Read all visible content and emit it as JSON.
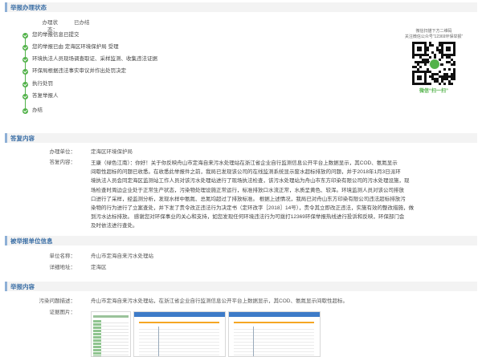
{
  "sections": {
    "status": "举报办理状态",
    "reply": "答复内容",
    "reported": "被举报单位信息",
    "report": "举报内容"
  },
  "status": {
    "label": "办理状态：",
    "value": "已办结",
    "steps": [
      "您的举报信息已提交",
      "您的举报已由 定海区环境保护局 受理",
      "环境执法人员现场调查取证、采样监测、收集违法证据",
      "环保局根据违法事实审议并作出处罚决定",
      "执行处罚",
      "答复举报人",
      "办结"
    ]
  },
  "wechat": {
    "line1": "微信扫描下方二维码",
    "line2": "关注微信公众号“12369环保举报”",
    "caption": "微信“扫一扫”"
  },
  "reply": {
    "unit_label": "办理单位：",
    "unit_value": "定海区环境保护局",
    "content_label": "答复内容：",
    "content_lines": [
      "王康（绿色江南）：你好！关于你反映舟山市定海自来污水处理站在浙江省企业自行监测信息公开平台上数据显示，其COD、氨氮显示",
      "间歇性超标的问题已收悉。在收悉此举报件之前，我局已发现该公司的在线监测系统显示废水超标排放的问题，并于2018年1月3日派环",
      "境执法人员会同定海区监测站工作人员对该污水处理站进行了现场执法检查，该污水处理站为舟山市东方印染有限公司的污水处理设施，现",
      "场检查时周边企业处于正常生产状态，污染物处理设施正常运行，标准排放口水流正常，水质呈黄色、较浑。环境监测人员对该公司排放",
      "口进行了采样，经监测分析，发现水样中氨氮、总氮均超过了排放标准。 根据上述情况，我局已对舟山东方印染有限公司违法超标排放污",
      "染物的行为进行了立案查处，并下发了责令改正违法行为决定书（定环改字［2018］14号），责令其立即改正违法，实施有效的整改措施，做",
      "到污水达标排放。 感谢您对环保事业的关心和支持，如您发现任何环境违法行为可拨打12369环保举报热线进行投诉和反映，环保部门会",
      "及时依法进行查处。"
    ]
  },
  "reported": {
    "name_label": "单位名称：",
    "name_value": "舟山市定海自来污水处理站",
    "addr_label": "详细地址：",
    "addr_value": "定海区"
  },
  "report": {
    "desc_label": "污染问题描述：",
    "desc_value": "舟山市定海自来污水处理站，在浙江省企业自行监测信息公开平台上数据显示，其COD、氨氮显示间歇性超标。",
    "img_label": "证据图片："
  },
  "colors": {
    "accent": "#3a6ea5",
    "step": "#52b24a",
    "wechat": "#52b24a"
  }
}
